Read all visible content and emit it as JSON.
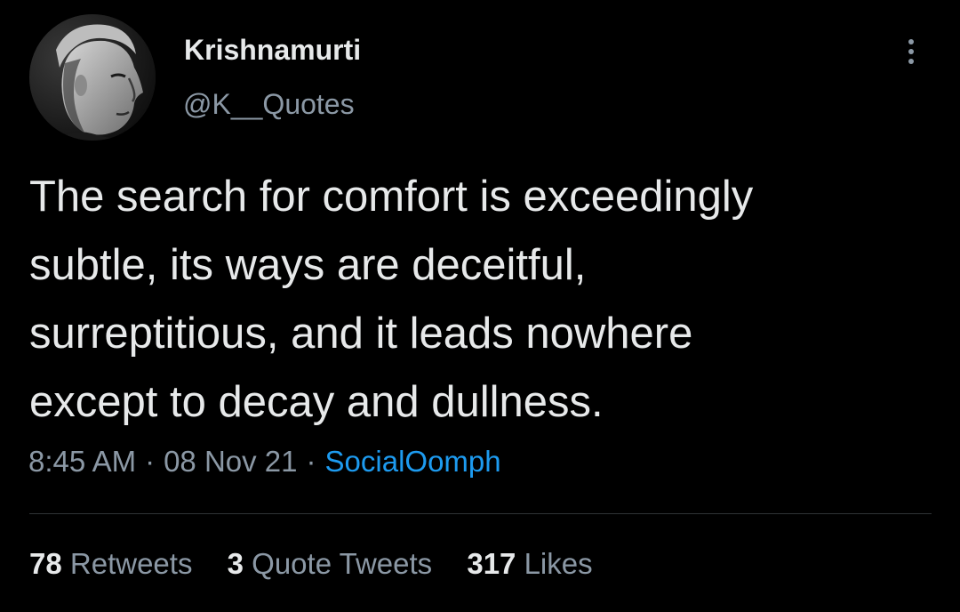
{
  "tweet": {
    "display_name": "Krishnamurti",
    "handle": "@K__Quotes",
    "text_lines": [
      "The search for comfort is exceedingly",
      "subtle, its ways are deceitful,",
      "surreptitious, and it leads nowhere",
      "except to decay and dullness."
    ],
    "time": "8:45 AM",
    "separator": "·",
    "date": "08 Nov 21",
    "source": "SocialOomph",
    "icons": {
      "more": "more-vertical-icon",
      "avatar": "avatar-portrait"
    }
  },
  "stats": {
    "retweets_count": "78",
    "retweets_label": "Retweets",
    "quote_tweets_count": "3",
    "quote_tweets_label": "Quote Tweets",
    "likes_count": "317",
    "likes_label": "Likes"
  },
  "colors": {
    "background": "#000000",
    "primary_text": "#e7e9ea",
    "secondary_text": "#8b98a5",
    "link": "#1d9bf0",
    "divider": "#2f3336"
  }
}
